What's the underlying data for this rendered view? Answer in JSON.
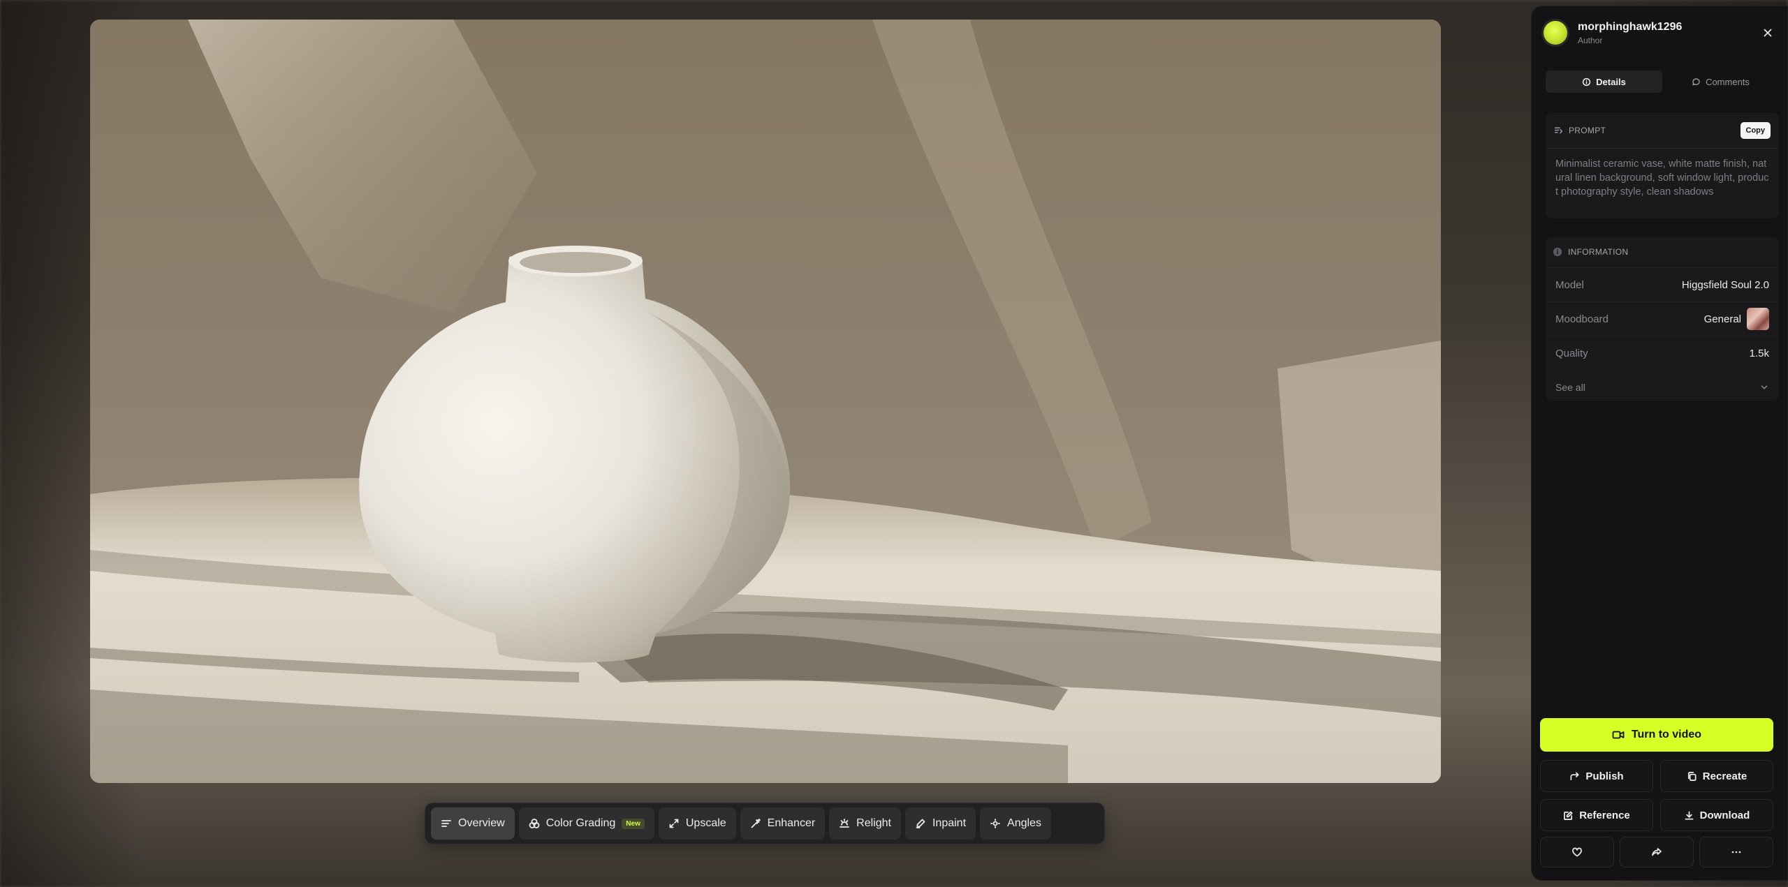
{
  "author": {
    "name": "morphinghawk1296",
    "role": "Author"
  },
  "tabs": [
    {
      "label": "Details",
      "active": true
    },
    {
      "label": "Comments",
      "active": false
    }
  ],
  "prompt": {
    "label": "PROMPT",
    "copy_label": "Copy",
    "text": "Minimalist ceramic vase, white matte finish, natural linen background, soft window light, product photography style, clean shadows"
  },
  "information": {
    "label": "INFORMATION",
    "rows": [
      {
        "key": "Model",
        "value": "Higgsfield Soul 2.0"
      },
      {
        "key": "Moodboard",
        "value": "General"
      },
      {
        "key": "Quality",
        "value": "1.5k"
      }
    ],
    "see_all": "See all"
  },
  "actions": {
    "turn_to_video": "Turn to video",
    "publish": "Publish",
    "recreate": "Recreate",
    "reference": "Reference",
    "download": "Download"
  },
  "toolbar": [
    {
      "label": "Overview",
      "icon": "overview-icon",
      "active": true
    },
    {
      "label": "Color Grading",
      "icon": "color-grading-icon",
      "badge": "New"
    },
    {
      "label": "Upscale",
      "icon": "upscale-icon"
    },
    {
      "label": "Enhancer",
      "icon": "enhancer-icon"
    },
    {
      "label": "Relight",
      "icon": "relight-icon"
    },
    {
      "label": "Inpaint",
      "icon": "inpaint-icon"
    },
    {
      "label": "Angles",
      "icon": "angles-icon"
    }
  ],
  "colors": {
    "accent": "#d6ff26",
    "panel_bg": "#131315",
    "card_bg": "#1a1a1c"
  }
}
